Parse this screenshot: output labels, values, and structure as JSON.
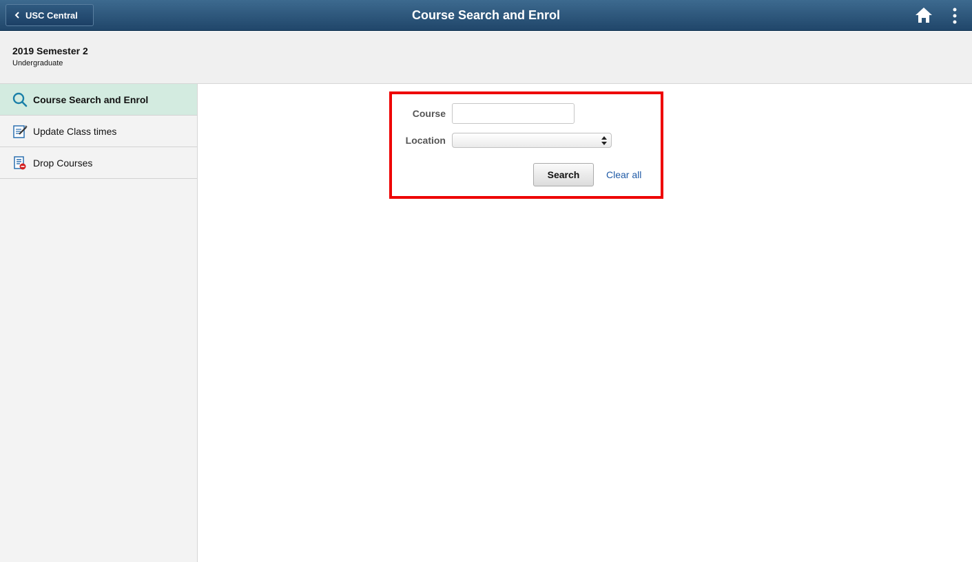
{
  "banner": {
    "back_label": "USC Central",
    "title": "Course Search and Enrol",
    "icons": [
      "chevron-left-icon",
      "home-icon",
      "more-vertical-icon"
    ]
  },
  "term": {
    "name": "2019 Semester 2",
    "career": "Undergraduate"
  },
  "sidebar": {
    "items": [
      {
        "label": "Course Search and Enrol",
        "icon": "search-icon",
        "active": true
      },
      {
        "label": "Update Class times",
        "icon": "edit-document-icon",
        "active": false
      },
      {
        "label": "Drop Courses",
        "icon": "drop-document-icon",
        "active": false
      }
    ]
  },
  "form": {
    "course_label": "Course",
    "course_value": "",
    "location_label": "Location",
    "location_value": "",
    "search_label": "Search",
    "clear_label": "Clear all"
  },
  "colors": {
    "banner": "#2b5478",
    "active_nav": "#d3ebe0",
    "highlight_box": "#ee0000",
    "link": "#1f5aa6"
  }
}
